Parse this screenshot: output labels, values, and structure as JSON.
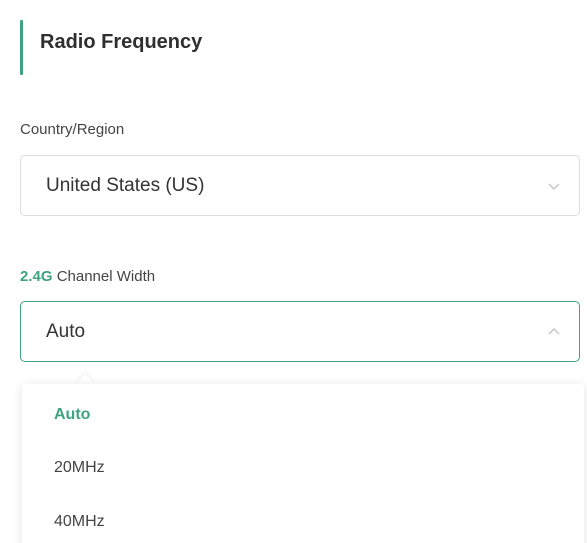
{
  "section": {
    "title": "Radio Frequency",
    "accent_color": "#3fa382"
  },
  "country": {
    "label": "Country/Region",
    "value": "United States (US)",
    "icon": "chevron-down-icon"
  },
  "channel_width": {
    "label_highlight": "2.4G",
    "label_rest": " Channel Width",
    "value": "Auto",
    "icon": "chevron-up-icon",
    "options": [
      "Auto",
      "20MHz",
      "40MHz"
    ],
    "selected": "Auto"
  }
}
